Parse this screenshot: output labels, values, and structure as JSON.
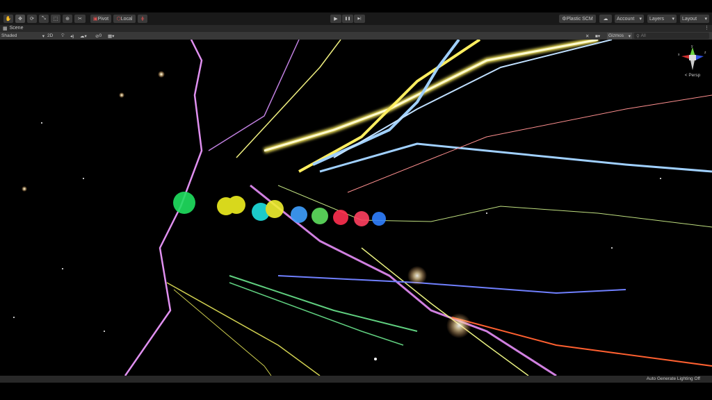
{
  "toolbar": {
    "tools": [
      {
        "name": "hand-tool-icon",
        "glyph": "✋"
      },
      {
        "name": "move-tool-icon",
        "glyph": "✥"
      },
      {
        "name": "rotate-tool-icon",
        "glyph": "⟳"
      },
      {
        "name": "scale-tool-icon",
        "glyph": "⤡"
      },
      {
        "name": "rect-tool-icon",
        "glyph": "⬚"
      },
      {
        "name": "transform-tool-icon",
        "glyph": "⊕"
      },
      {
        "name": "custom-tool-icon",
        "glyph": "✂"
      }
    ],
    "pivot": "Pivot",
    "local": "Local",
    "play": "▶",
    "pause": "❚❚",
    "step": "▶|",
    "plastic_scm": "Plastic SCM",
    "account": "Account",
    "layers": "Layers",
    "layout": "Layout"
  },
  "scene_tab": {
    "label": "Scene"
  },
  "scene_toolbar": {
    "shading": "Shaded",
    "mode_2d": "2D",
    "hidden_count": "0",
    "gizmos": "Gizmos",
    "search_placeholder": "All"
  },
  "viewport": {
    "projection": "Persp",
    "axis_y": "y",
    "axis_x": "x",
    "axis_z": "z"
  },
  "status": {
    "lighting": "Auto Generate Lighting Off"
  },
  "colors": {
    "accent": "#3a3a3a",
    "bg": "#191919"
  }
}
